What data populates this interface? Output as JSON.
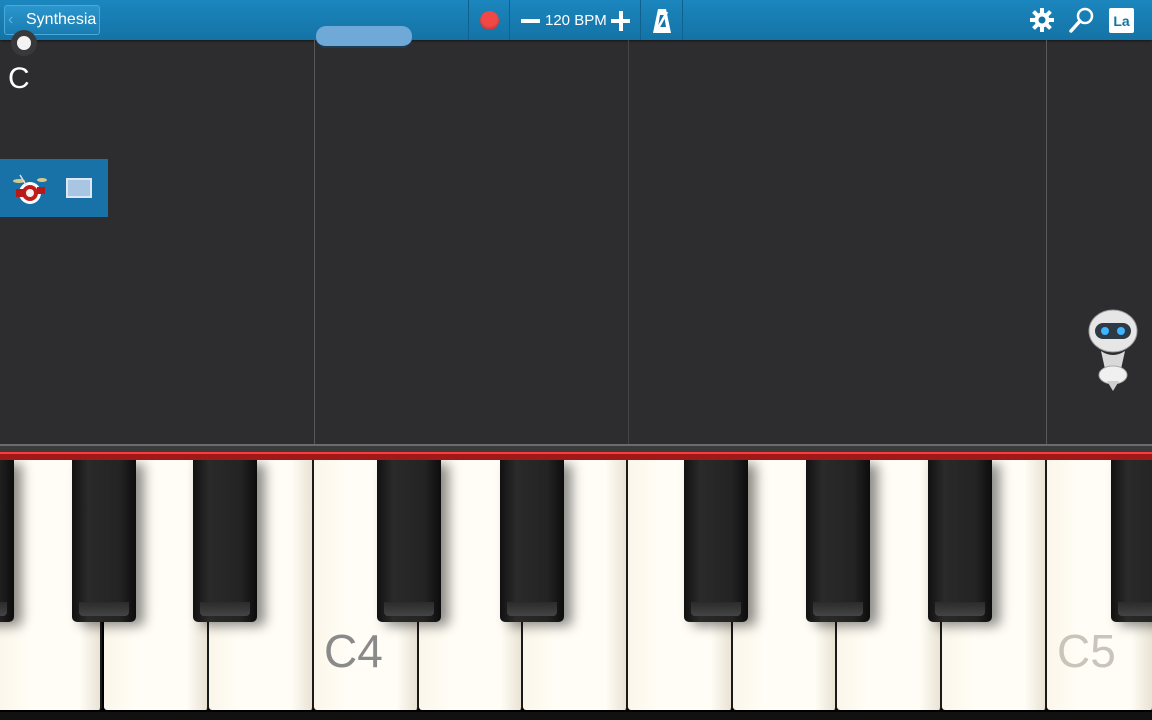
{
  "topbar": {
    "back_label": "Synthesia",
    "bpm_text": "120 BPM",
    "record_icon": "record-icon",
    "metronome_icon": "metronome-icon",
    "settings_icon": "gear-icon",
    "search_icon": "magnifier-icon",
    "label_mode": "La",
    "accent_color": "#1473a6",
    "record_color": "#f24747"
  },
  "notearea": {
    "key_label": "C",
    "instrument_icon": "drum-kit-icon",
    "screen_icon": "screen-icon",
    "robot_icon": "robot-icon"
  },
  "keyboard": {
    "octave_labels": [
      "C4",
      "C5"
    ],
    "highlight_color": "#a01818"
  }
}
